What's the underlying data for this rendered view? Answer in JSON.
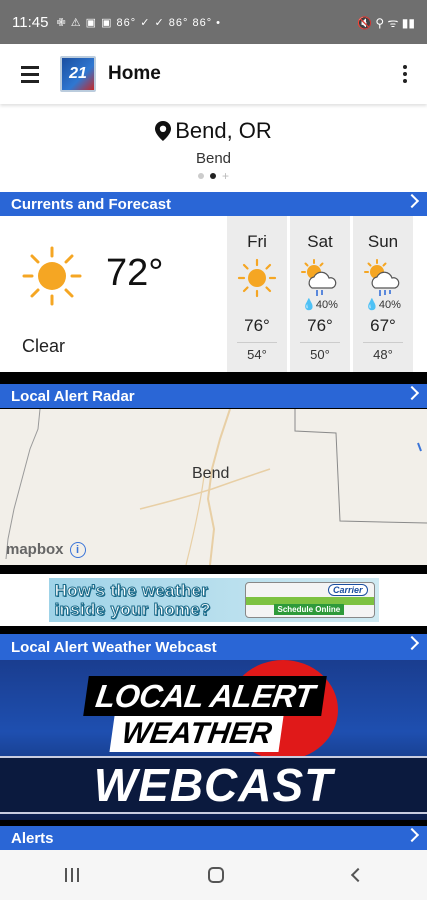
{
  "status_bar": {
    "time": "11:45",
    "icons_text": "✙ ⚠ ▣ ▣ 86° ✓ ✓ 86° 86° •",
    "right_icons": "🔇 ⚲ ᯤ ▮▮"
  },
  "app_bar": {
    "logo_text": "21",
    "title": "Home"
  },
  "location": {
    "city": "Bend, OR",
    "subtitle": "Bend",
    "page_indicator_add": "+"
  },
  "sections": {
    "currents": "Currents and Forecast",
    "radar": "Local Alert Radar",
    "webcast": "Local Alert Weather Webcast",
    "alerts": "Alerts"
  },
  "current": {
    "temp": "72°",
    "condition": "Clear",
    "icon": "sun-icon"
  },
  "forecast": [
    {
      "day": "Fri",
      "icon": "sun-icon",
      "precip": "",
      "hi": "76°",
      "lo": "54°"
    },
    {
      "day": "Sat",
      "icon": "partly-cloudy-rain-icon",
      "precip": "40%",
      "hi": "76°",
      "lo": "50°"
    },
    {
      "day": "Sun",
      "icon": "partly-cloudy-rain-icon",
      "precip": "40%",
      "hi": "67°",
      "lo": "48°"
    }
  ],
  "radar": {
    "city_label": "Bend",
    "attribution": "mapbox",
    "info": "i"
  },
  "ad": {
    "line1": "How's the weather",
    "line2": "inside your home?",
    "brand": "Carrier",
    "cta": "Schedule Online"
  },
  "webcast": {
    "local": "LOCAL",
    "alert": "ALERT",
    "weather": "WEATHER",
    "webcast": "WEBCAST"
  },
  "colors": {
    "section_bar": "#2a66d6",
    "status_bar": "#6f6f6f",
    "sun": "#f5a623",
    "rain_drop": "#1a66d0"
  }
}
